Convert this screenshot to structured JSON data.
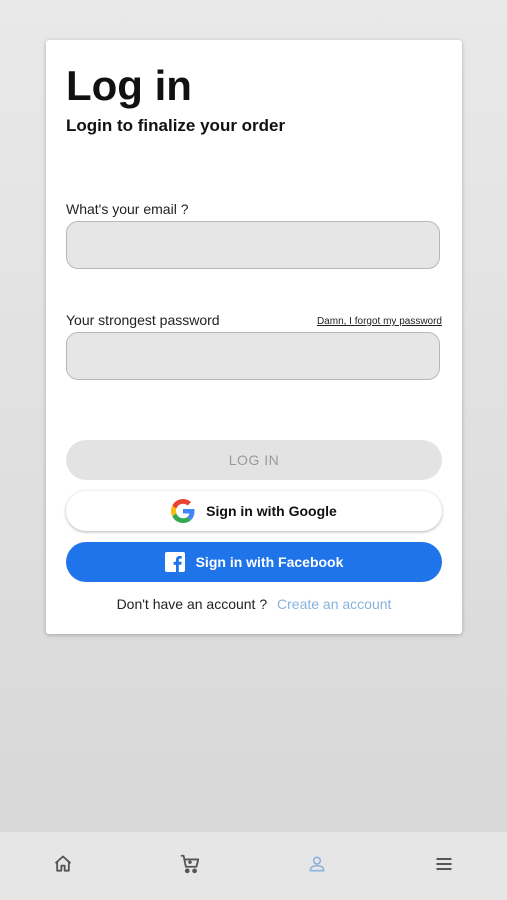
{
  "login": {
    "title": "Log in",
    "subtitle": "Login to finalize your order",
    "email_label": "What's your email ?",
    "email_value": "",
    "password_label": "Your strongest password",
    "password_value": "",
    "forgot_link": "Damn, I forgot my password",
    "login_button": "LOG IN",
    "google_button": "Sign in with Google",
    "facebook_button": "Sign in with Facebook",
    "no_account_text": "Don't have an account ?",
    "create_account_link": "Create an account"
  },
  "icons": {
    "google": "google-logo-icon",
    "facebook": "facebook-logo-icon"
  },
  "bottom_nav": [
    {
      "icon": "home-icon",
      "active": false
    },
    {
      "icon": "cart-icon",
      "active": false
    },
    {
      "icon": "user-icon",
      "active": true
    },
    {
      "icon": "menu-icon",
      "active": false
    }
  ],
  "colors": {
    "facebook_blue": "#1f74ea",
    "link_blue": "#88b2de",
    "active_nav": "#8fb3dc",
    "nav_icon": "#555555"
  }
}
